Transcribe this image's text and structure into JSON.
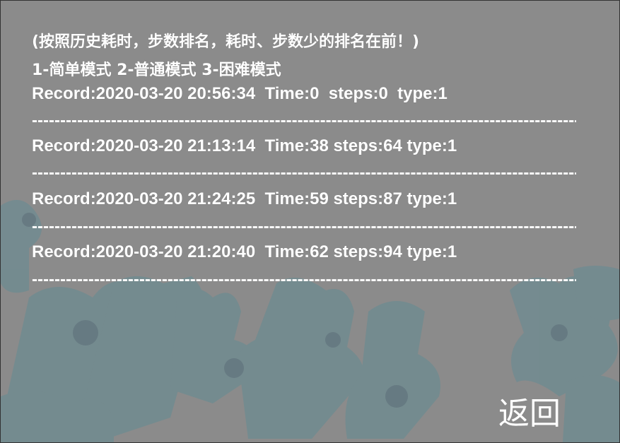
{
  "header": {
    "note": "(按照历史耗时，步数排名，耗时、步数少的排名在前！)",
    "modes": "1-简单模式 2-普通模式 3-困难模式"
  },
  "records": [
    {
      "text": "Record:2020-03-20 20:56:34  Time:0  steps:0  type:1"
    },
    {
      "text": "Record:2020-03-20 21:13:14  Time:38 steps:64 type:1"
    },
    {
      "text": "Record:2020-03-20 21:24:25  Time:59 steps:87 type:1"
    },
    {
      "text": "Record:2020-03-20 21:20:40  Time:62 steps:94 type:1"
    }
  ],
  "separator": "------------------------------------------------------------------------------------------------------",
  "back_label": "返回",
  "colors": {
    "background": "#8b8b8b",
    "puzzle": "#6f8c92",
    "text": "#ffffff"
  }
}
